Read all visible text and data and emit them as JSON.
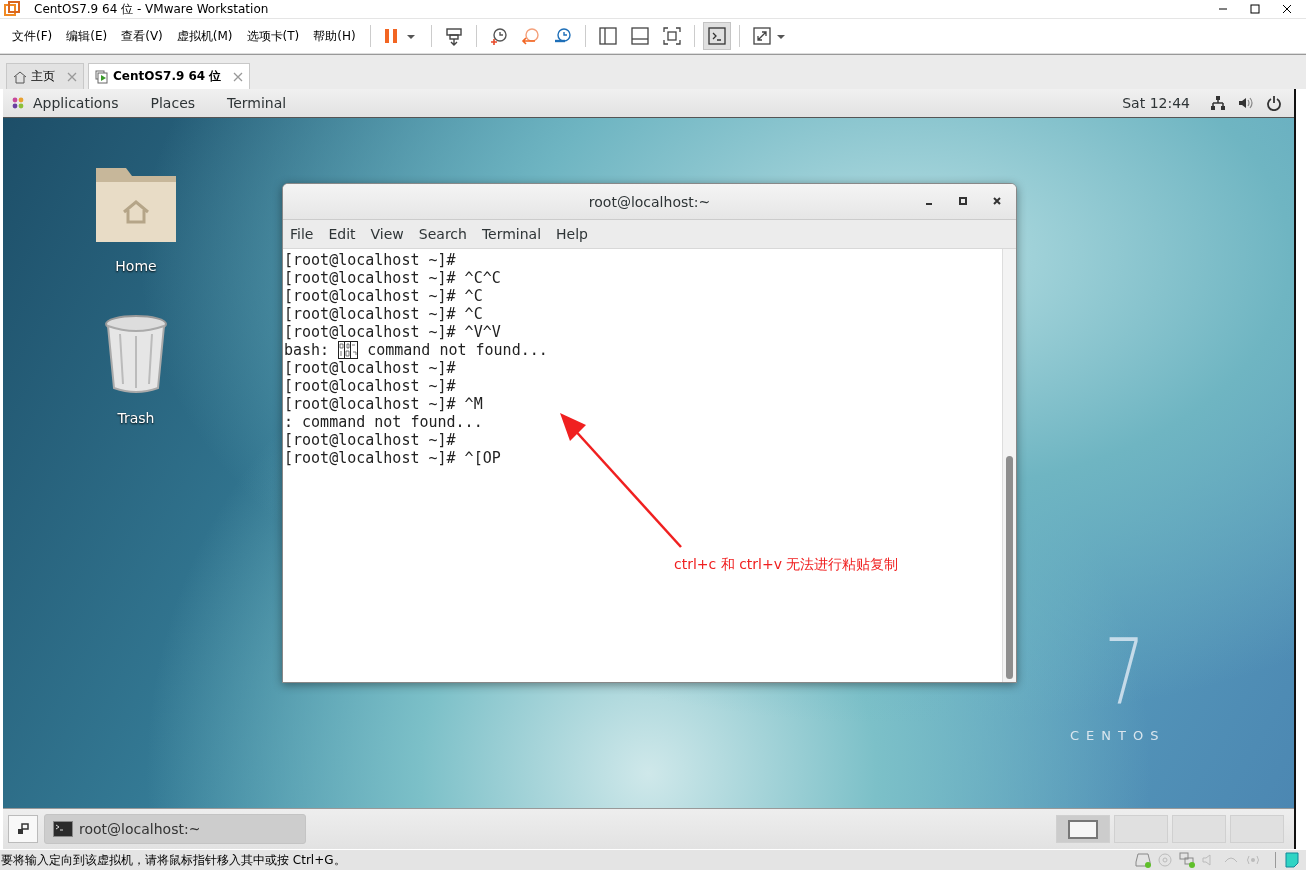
{
  "window": {
    "title": "CentOS7.9 64 位 - VMware Workstation"
  },
  "menu": [
    "文件(F)",
    "编辑(E)",
    "查看(V)",
    "虚拟机(M)",
    "选项卡(T)",
    "帮助(H)"
  ],
  "toolbar": [
    {
      "kind": "pause",
      "selected": false
    },
    {
      "kind": "send_keys",
      "selected": false
    },
    {
      "kind": "snapshot",
      "selected": false
    },
    {
      "kind": "revert",
      "selected": false
    },
    {
      "kind": "manage",
      "selected": false
    },
    {
      "kind": "sidebar",
      "selected": false
    },
    {
      "kind": "thumbnail",
      "selected": false
    },
    {
      "kind": "fit",
      "selected": false
    },
    {
      "kind": "console",
      "selected": true
    },
    {
      "kind": "fullscreen",
      "selected": false
    }
  ],
  "tabs": [
    {
      "kind": "home",
      "label": "主页",
      "selected": false
    },
    {
      "kind": "vm",
      "label": "CentOS7.9 64 位",
      "selected": true
    }
  ],
  "gnome_bar": {
    "menus": [
      "Applications",
      "Places",
      "Terminal"
    ],
    "clock": "Sat 12:44"
  },
  "desktop_icons": [
    {
      "kind": "folder",
      "label": "Home"
    },
    {
      "kind": "trash",
      "label": "Trash"
    }
  ],
  "terminal": {
    "title": "root@localhost:~",
    "menu": [
      "File",
      "Edit",
      "View",
      "Search",
      "Terminal",
      "Help"
    ],
    "lines": [
      {
        "kind": "text",
        "text": "[root@localhost ~]#"
      },
      {
        "kind": "text",
        "text": "[root@localhost ~]# ^C^C"
      },
      {
        "kind": "text",
        "text": "[root@localhost ~]# ^C"
      },
      {
        "kind": "text",
        "text": "[root@localhost ~]# ^C"
      },
      {
        "kind": "text",
        "text": "[root@localhost ~]# ^V^V"
      },
      {
        "kind": "glyph_error",
        "before": "bash:",
        "after": "command not found..."
      },
      {
        "kind": "text",
        "text": "[root@localhost ~]#"
      },
      {
        "kind": "text",
        "text": "[root@localhost ~]#"
      },
      {
        "kind": "text",
        "text": "[root@localhost ~]# ^M"
      },
      {
        "kind": "text",
        "text": ": command not found..."
      },
      {
        "kind": "text",
        "text": "[root@localhost ~]#"
      },
      {
        "kind": "text",
        "text": "[root@localhost ~]# ^[OP"
      }
    ]
  },
  "annotation": {
    "text": "ctrl+c 和 ctrl+v 无法进行粘贴复制"
  },
  "logo": {
    "number": "7",
    "name": "CENTOS"
  },
  "taskbar": {
    "windows": [
      {
        "label": "root@localhost:~",
        "selected": true
      }
    ],
    "workspaces": [
      {
        "selected": true
      },
      {
        "selected": false
      },
      {
        "selected": false
      },
      {
        "selected": false
      }
    ]
  },
  "status_bar": {
    "message": "要将输入定向到该虚拟机，请将鼠标指针移入其中或按 Ctrl+G。"
  }
}
